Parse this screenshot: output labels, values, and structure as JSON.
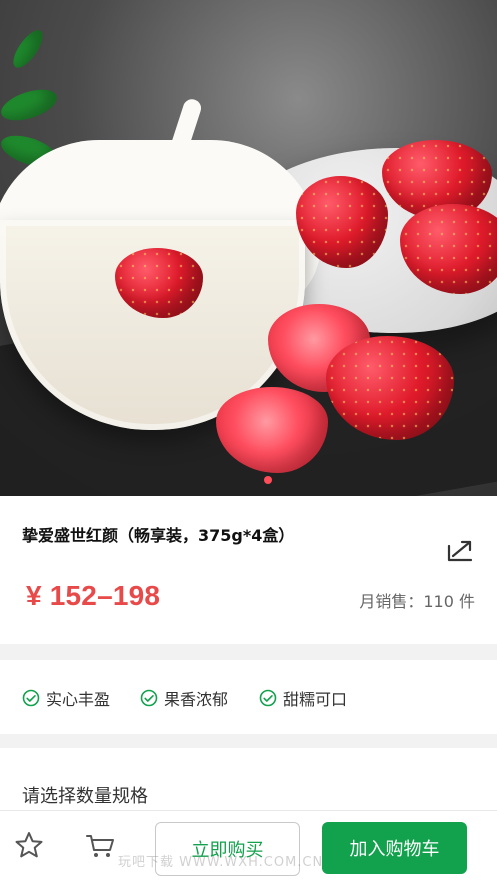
{
  "product": {
    "title": "挚爱盛世红颜（畅享装，375g*4盒）",
    "price": "¥ 152–198",
    "monthly_sales": "月销售：110 件"
  },
  "tags": [
    {
      "label": "实心丰盈"
    },
    {
      "label": "果香浓郁"
    },
    {
      "label": "甜糯可口"
    }
  ],
  "spec": {
    "label": "请选择数量规格"
  },
  "actions": {
    "buy_now": "立即购买",
    "add_to_cart": "加入购物车"
  },
  "watermark": {
    "text": "玩吧下载 WWW.WXH.COM.CN"
  },
  "colors": {
    "accent_green": "#12a14d",
    "price_red": "#e84a4a",
    "carousel_dot": "#ff4d5a"
  },
  "icons": {
    "favorite": "star-outline-icon",
    "cart": "cart-icon",
    "share": "share-icon"
  }
}
